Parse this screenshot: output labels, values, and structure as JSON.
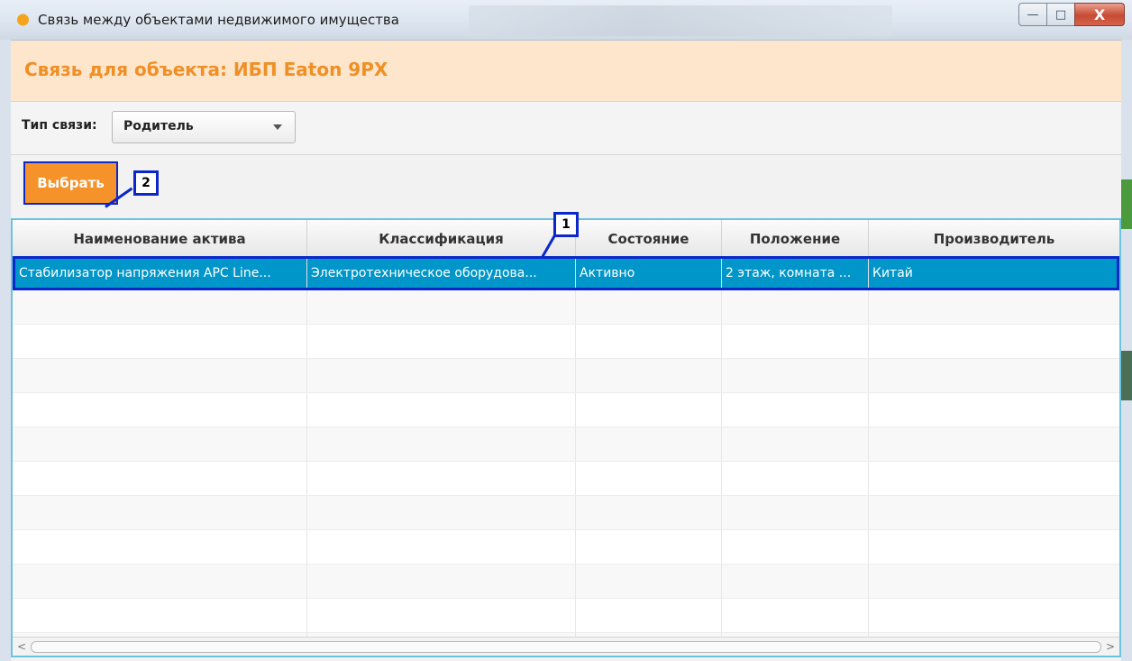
{
  "window": {
    "title": "Связь между объектами недвижимого имущества",
    "buttons": {
      "minimize": "—",
      "maximize": "□",
      "close": "X"
    }
  },
  "header": {
    "title": "Связь для объекта: ИБП Eaton 9PX"
  },
  "link_type": {
    "label": "Тип связи:",
    "selected": "Родитель"
  },
  "actions": {
    "select_label": "Выбрать"
  },
  "markers": {
    "row_marker": "1",
    "button_marker": "2"
  },
  "table": {
    "columns": [
      "Наименование актива",
      "Классификация",
      "Состояние",
      "Положение",
      "Производитель"
    ],
    "rows": [
      [
        "Стабилизатор напряжения APC Line...",
        "Электротехническое оборудова...",
        "Активно",
        "2 этаж, комната ...",
        "Китай"
      ]
    ],
    "scroll": {
      "left": "<",
      "right": ">"
    }
  },
  "colors": {
    "accent_orange": "#f5922a",
    "header_band": "#fde6cc",
    "selection": "#0096c9",
    "annotation_blue": "#0b27c9"
  }
}
